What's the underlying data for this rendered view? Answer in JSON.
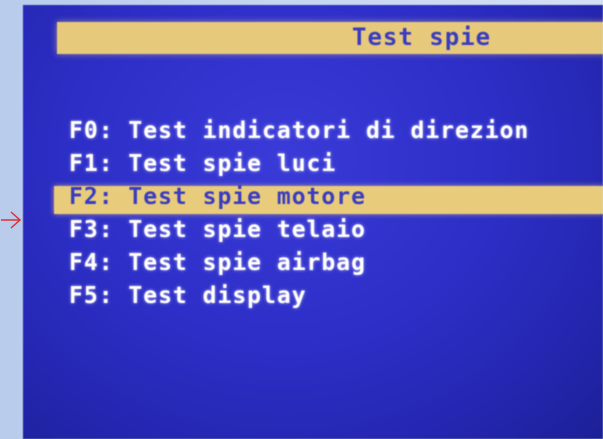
{
  "screen": {
    "title": "Test spie"
  },
  "menu": {
    "items": [
      {
        "label": "F0: Test indicatori di direzion"
      },
      {
        "label": "F1: Test spie luci"
      },
      {
        "label": "F2: Test spie motore"
      },
      {
        "label": "F3: Test spie telaio"
      },
      {
        "label": "F4: Test spie airbag"
      },
      {
        "label": "F5: Test display"
      }
    ],
    "selected_index": 2
  },
  "colors": {
    "screen_blue": "#2e2fc8",
    "highlight_yellow": "#e6c97a",
    "text_white": "#ffffff",
    "arrow_red": "#e03030"
  },
  "icons": {
    "pointer": "arrow-right-icon"
  }
}
